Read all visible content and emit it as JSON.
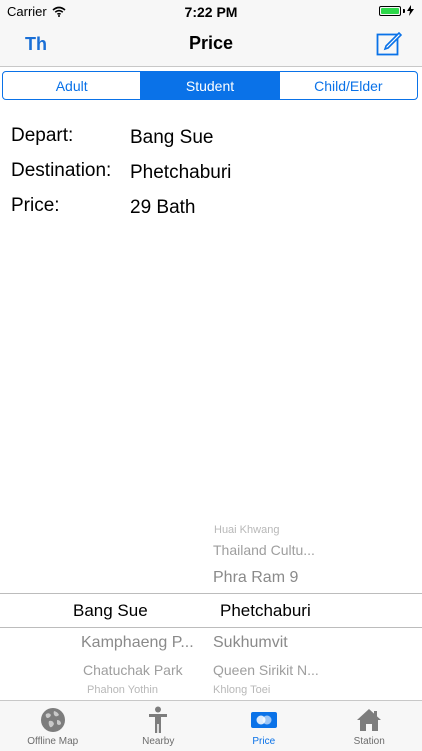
{
  "status_bar": {
    "carrier": "Carrier",
    "time": "7:22 PM"
  },
  "nav": {
    "language_button": "Th",
    "title": "Price"
  },
  "segments": {
    "adult": "Adult",
    "student": "Student",
    "child_elder": "Child/Elder",
    "selected": "Student"
  },
  "info": {
    "depart_label": "Depart:",
    "depart_value": "Bang Sue",
    "destination_label": "Destination:",
    "destination_value": "Phetchaburi",
    "price_label": "Price:",
    "price_value": "29  Bath"
  },
  "picker": {
    "left_column": {
      "selected": "Bang Sue",
      "below": [
        "Kamphaeng P...",
        "Chatuchak Park",
        "Phahon Yothin"
      ]
    },
    "right_column": {
      "above": [
        "Huai Khwang",
        "Thailand Cultu...",
        "Phra Ram 9"
      ],
      "selected": "Phetchaburi",
      "below": [
        "Sukhumvit",
        "Queen Sirikit N...",
        "Khlong Toei"
      ]
    }
  },
  "tab_bar": {
    "offline_map": "Offline Map",
    "nearby": "Nearby",
    "price": "Price",
    "station": "Station",
    "active": "Price"
  },
  "colors": {
    "accent": "#0a72e8",
    "nav_text": "#1a6fd6",
    "battery": "#2dd84a",
    "inactive_tab": "#6d6d6d",
    "picker_faded": "#8a8a8a"
  },
  "icons": {
    "wifi": "wifi-icon",
    "battery": "battery-icon",
    "charging": "charging-icon",
    "edit": "compose-icon",
    "offline_map": "globe-icon",
    "nearby": "person-icon",
    "price": "card-icon",
    "station": "house-icon"
  }
}
